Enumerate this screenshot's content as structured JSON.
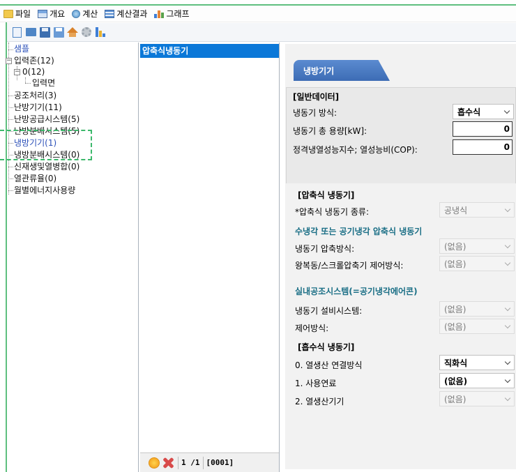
{
  "menu": [
    {
      "label": "파일",
      "icon": "folder-icon"
    },
    {
      "label": "개요",
      "icon": "summary-icon"
    },
    {
      "label": "계산",
      "icon": "calc-icon"
    },
    {
      "label": "계산결과",
      "icon": "result-table-icon"
    },
    {
      "label": "그래프",
      "icon": "bar-chart-icon"
    }
  ],
  "toolbar": [
    "new-file-icon",
    "open-folder-icon",
    "save-icon",
    "save-as-icon",
    "home-icon",
    "settings-gear-icon",
    "chart-icon"
  ],
  "tree": {
    "sample": "샘플",
    "input_zone": "입력존(12)",
    "zone_0": "0(12)",
    "input_face": "입력면",
    "air_handling": "공조처리(3)",
    "heating_equipment": "난방기기(11)",
    "heating_supply": "난방공급시스템(5)",
    "heating_distribution": "난방분배시스템(5)",
    "cooling_equipment": "냉방기기(1)",
    "cooling_distribution": "냉방분배시스템(0)",
    "renewable_chp": "신재생및열병합(0)",
    "heat_loss_rate": "열관류율(0)",
    "monthly_energy": "월별에너지사용량"
  },
  "list": {
    "selected_item": "압축식냉동기",
    "page": "1 /1",
    "code": "[0001]"
  },
  "main": {
    "tab_title": "냉방기기",
    "general": {
      "title": "[일반데이터]",
      "chiller_type_label": "냉동기 방식:",
      "chiller_type_value": "흡수식",
      "total_capacity_label": "냉동기 총 용량[kW]:",
      "total_capacity_value": "0",
      "cop_label": "정격냉열성능지수; 열성능비(COP):",
      "cop_value": "0"
    },
    "compression": {
      "title": "[압축식 냉동기]",
      "type_label": "*압축식 냉동기 종류:",
      "type_value": "공냉식",
      "sub_title": "수냉각 또는 공기냉각 압축식 냉동기",
      "compressor_label": "냉동기 압축방식:",
      "compressor_value": "(없음)",
      "control_label": "왕복동/스크롤압축기 제어방식:",
      "control_value": "(없음)",
      "indoor_title": "실내공조시스템(=공기냉각에어콘)",
      "equipment_label": "냉동기 설비시스템:",
      "equipment_value": "(없음)",
      "control_method_label": "제어방식:",
      "control_method_value": "(없음)"
    },
    "absorption": {
      "title": "[흡수식 냉동기]",
      "connection_label": "0. 열생산 연결방식",
      "connection_value": "직화식",
      "fuel_label": "1. 사용연료",
      "fuel_value": "(없음)",
      "heat_producer_label": "2. 열생산기기",
      "heat_producer_value": "(없음)"
    }
  }
}
